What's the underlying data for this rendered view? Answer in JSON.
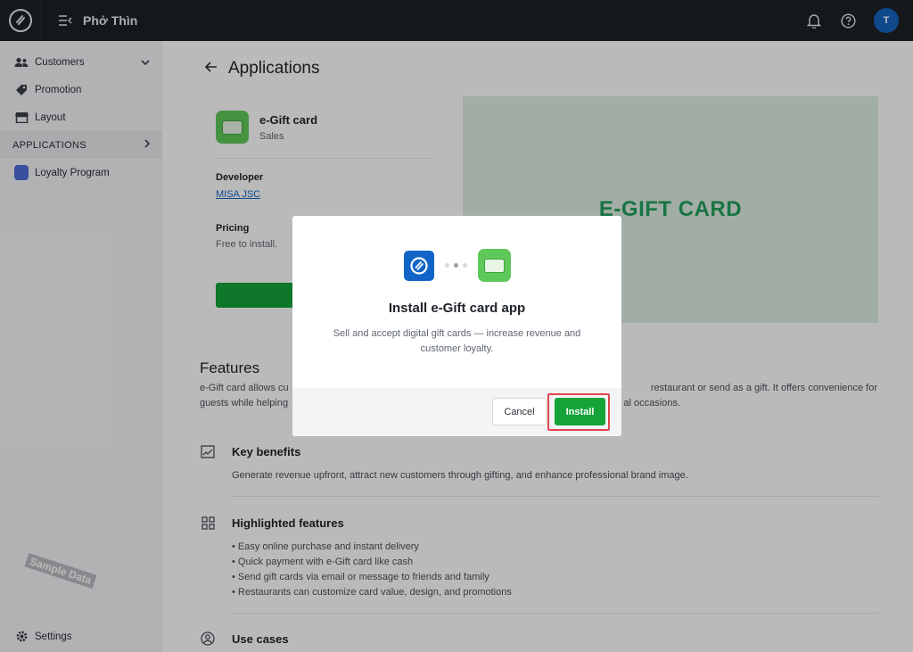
{
  "topbar": {
    "brand": "Phở Thìn",
    "avatar_initial": "T"
  },
  "sidebar": {
    "items": [
      {
        "label": "Customers",
        "icon": "users-icon"
      },
      {
        "label": "Promotion",
        "icon": "tag-icon"
      },
      {
        "label": "Layout",
        "icon": "storefront-icon"
      }
    ],
    "section": "APPLICATIONS",
    "app_item": {
      "label": "Loyalty Program",
      "icon": "loyalty-icon"
    },
    "settings": "Settings"
  },
  "watermark": "Sample Data",
  "page": {
    "title": "Applications"
  },
  "app": {
    "name": "e-Gift card",
    "category": "Sales",
    "developer_label": "Developer",
    "developer": "MISA JSC",
    "pricing_label": "Pricing",
    "pricing": "Free to install."
  },
  "banner": {
    "text": "E-GIFT CARD"
  },
  "features": {
    "title": "Features",
    "desc_left_1": "e-Gift card allows cu",
    "desc_right_1": "restaurant or send as a gift. It offers convenience for",
    "desc_left_2": "guests while helping",
    "desc_right_2": "al occasions.",
    "blocks": [
      {
        "title": "Key benefits",
        "body": "Generate revenue upfront, attract new customers through gifting, and enhance professional brand image."
      },
      {
        "title": "Highlighted features",
        "bullets": [
          "• Easy online purchase and instant delivery",
          "• Quick payment with e-Gift card like cash",
          "• Send gift cards via email or message to friends and family",
          "• Restaurants can customize card value, design, and promotions"
        ]
      },
      {
        "title": "Use cases"
      }
    ]
  },
  "modal": {
    "title": "Install e-Gift card app",
    "desc": "Sell and accept digital gift cards — increase revenue and customer loyalty.",
    "cancel": "Cancel",
    "install": "Install"
  },
  "colors": {
    "accent_green": "#15a33a",
    "topbar": "#1d2126",
    "highlight": "#e0454b",
    "brand_blue": "#1265c8"
  }
}
